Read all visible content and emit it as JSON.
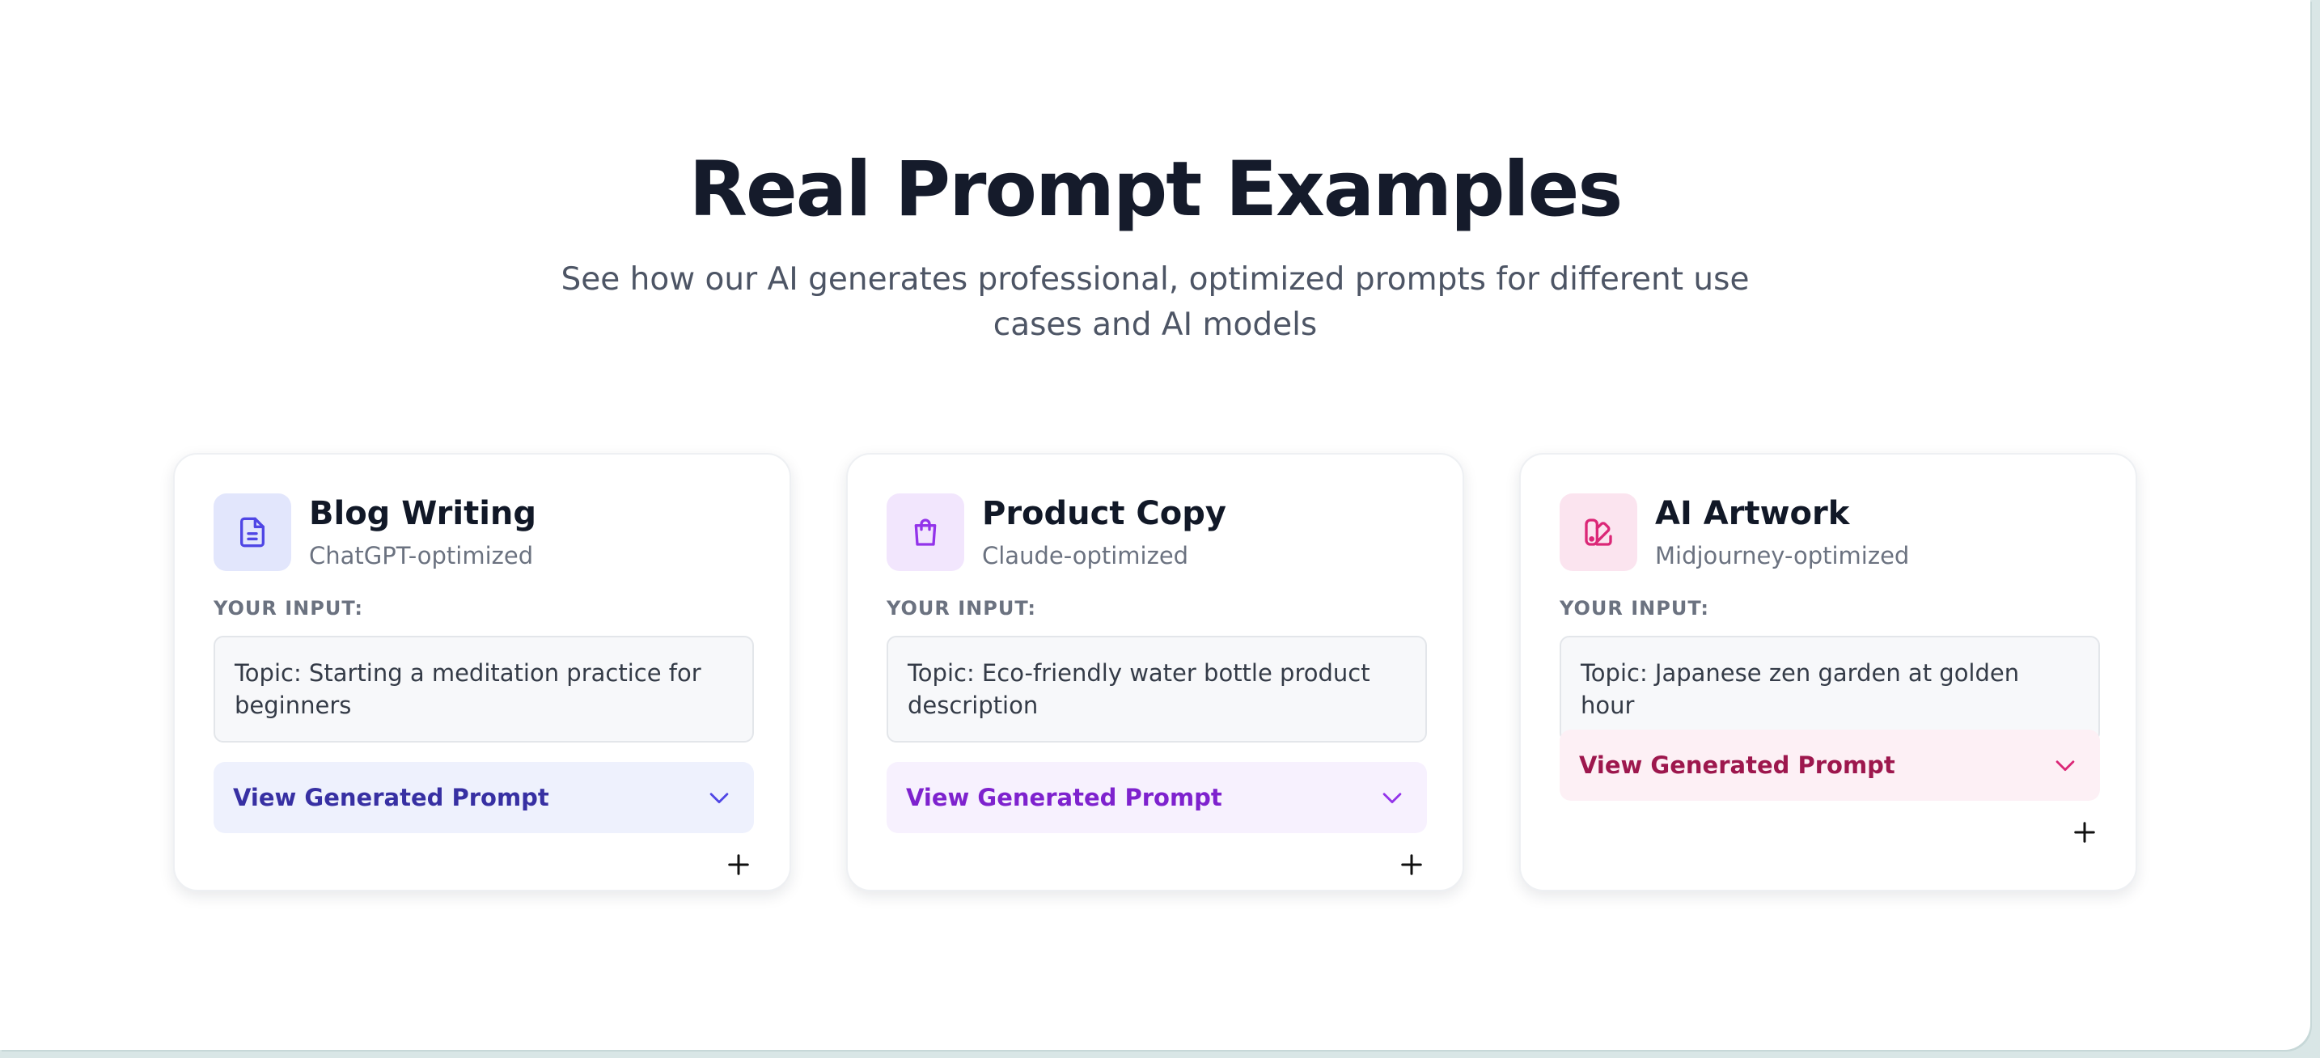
{
  "section": {
    "title": "Real Prompt Examples",
    "subtitle": "See how our AI generates professional, optimized prompts for different use cases and AI models"
  },
  "cards": [
    {
      "title": "Blog Writing",
      "subtitle": "ChatGPT-optimized",
      "icon": "document-icon",
      "input_label": "YOUR INPUT:",
      "input_text": "Topic: Starting a meditation practice for beginners",
      "button_label": "View Generated Prompt",
      "colors": {
        "icon_bg": "#e2e6fc",
        "icon": "#4f46e5",
        "button_bg": "#eef1fd",
        "button_text": "#3730a3"
      }
    },
    {
      "title": "Product Copy",
      "subtitle": "Claude-optimized",
      "icon": "shopping-bag-icon",
      "input_label": "YOUR INPUT:",
      "input_text": "Topic: Eco-friendly water bottle product description",
      "button_label": "View Generated Prompt",
      "colors": {
        "icon_bg": "#f2e6fd",
        "icon": "#9333ea",
        "button_bg": "#f7f1fe",
        "button_text": "#7e22ce"
      }
    },
    {
      "title": "AI Artwork",
      "subtitle": "Midjourney-optimized",
      "icon": "palette-icon",
      "input_label": "YOUR INPUT:",
      "input_text": "Topic: Japanese zen garden at golden hour",
      "button_label": "View Generated Prompt",
      "colors": {
        "icon_bg": "#fbe4ef",
        "icon": "#db2777",
        "button_bg": "#fdf0f5",
        "button_text": "#9d174d"
      }
    }
  ]
}
